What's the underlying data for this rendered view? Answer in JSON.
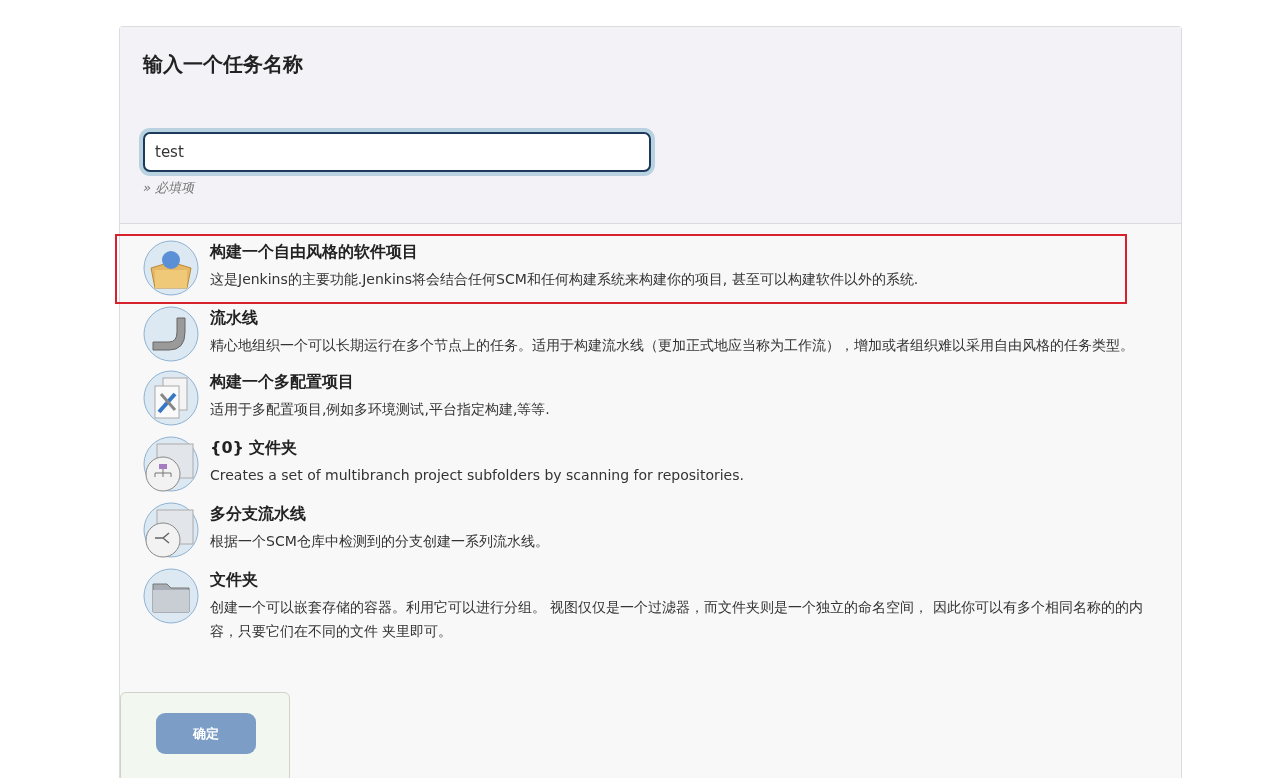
{
  "heading": "输入一个任务名称",
  "name_field": {
    "value": "test",
    "focused": true
  },
  "required_hint": "» 必填项",
  "items": [
    {
      "kind": "freestyle",
      "title": "构建一个自由风格的软件项目",
      "description": "这是Jenkins的主要功能.Jenkins将会结合任何SCM和任何构建系统来构建你的项目, 甚至可以构建软件以外的系统.",
      "highlighted": true
    },
    {
      "kind": "pipeline",
      "title": "流水线",
      "description": "精心地组织一个可以长期运行在多个节点上的任务。适用于构建流水线（更加正式地应当称为工作流），增加或者组织难以采用自由风格的任务类型。",
      "highlighted": false
    },
    {
      "kind": "multiconfig",
      "title": "构建一个多配置项目",
      "description": "适用于多配置项目,例如多环境测试,平台指定构建,等等.",
      "highlighted": false
    },
    {
      "kind": "orgfolder",
      "title": "{0} 文件夹",
      "description": "Creates a set of multibranch project subfolders by scanning for repositories.",
      "highlighted": false
    },
    {
      "kind": "multibranch",
      "title": "多分支流水线",
      "description": "根据一个SCM仓库中检测到的分支创建一系列流水线。",
      "highlighted": false
    },
    {
      "kind": "folder",
      "title": "文件夹",
      "description": "创建一个可以嵌套存储的容器。利用它可以进行分组。 视图仅仅是一个过滤器，而文件夹则是一个独立的命名空间， 因此你可以有多个相同名称的的内容，只要它们在不同的文件 夹里即可。",
      "highlighted": false
    }
  ],
  "footer": {
    "button": "确定",
    "disabled": true
  }
}
